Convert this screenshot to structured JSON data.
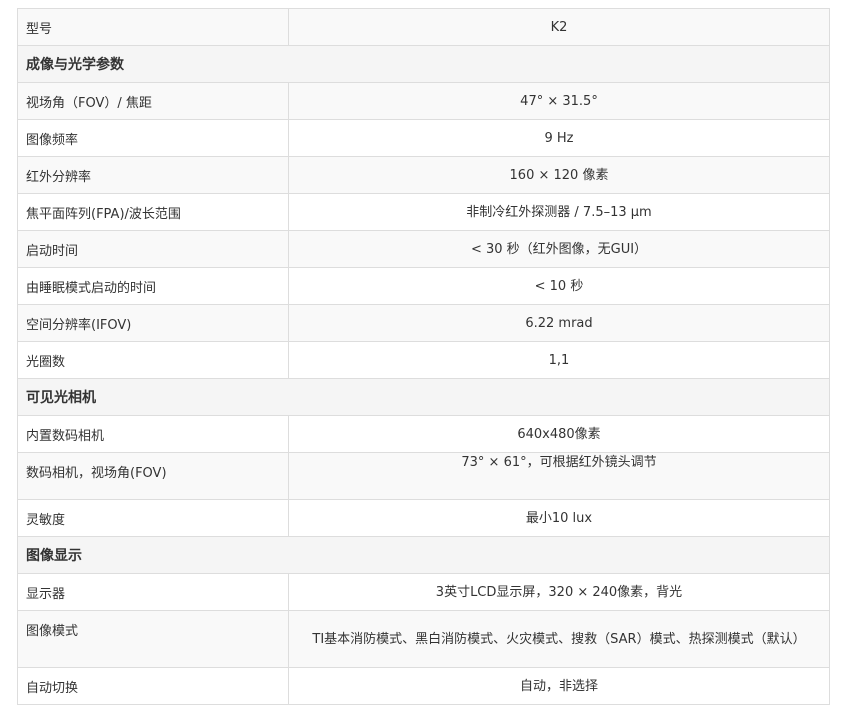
{
  "rows": [
    {
      "type": "data",
      "label": "型号",
      "value": "K2"
    },
    {
      "type": "section",
      "label": "成像与光学参数"
    },
    {
      "type": "data",
      "label": "视场角（FOV）/ 焦距",
      "value": "47°  × 31.5°"
    },
    {
      "type": "data",
      "label": "图像频率",
      "value": "9 Hz"
    },
    {
      "type": "data",
      "label": "红外分辨率",
      "value": "160 × 120 像素"
    },
    {
      "type": "data",
      "label": "焦平面阵列(FPA)/波长范围",
      "value": "非制冷红外探测器 / 7.5–13 μm"
    },
    {
      "type": "data",
      "label": "启动时间",
      "value": "< 30 秒（红外图像，无GUI）"
    },
    {
      "type": "data",
      "label": "由睡眠模式启动的时间",
      "value": "< 10 秒"
    },
    {
      "type": "data",
      "label": "空间分辨率(IFOV)",
      "value": "6.22 mrad"
    },
    {
      "type": "data",
      "label": "光圈数",
      "value": "1,1"
    },
    {
      "type": "section",
      "label": "可见光相机"
    },
    {
      "type": "data",
      "label": "内置数码相机",
      "value": "640x480像素"
    },
    {
      "type": "data",
      "label": "数码相机，视场角(FOV)",
      "value": "73°  × 61°，可根据红外镜头调节"
    },
    {
      "type": "data",
      "label": "灵敏度",
      "value": "最小10 lux"
    },
    {
      "type": "section",
      "label": "图像显示"
    },
    {
      "type": "data",
      "label": "显示器",
      "value": "3英寸LCD显示屏，320 × 240像素，背光"
    },
    {
      "type": "data",
      "label": "图像模式",
      "value": "TI基本消防模式、黑白消防模式、火灾模式、搜救（SAR）模式、热探测模式（默认）"
    },
    {
      "type": "data",
      "label": "自动切换",
      "value": "自动，非选择"
    }
  ]
}
